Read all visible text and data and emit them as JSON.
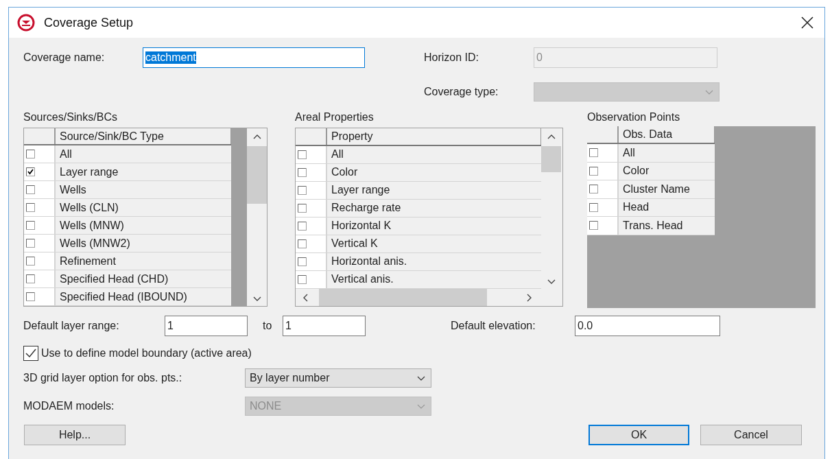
{
  "window": {
    "title": "Coverage Setup"
  },
  "coverage_name": {
    "label": "Coverage name:",
    "value": "catchment",
    "text_selected": true
  },
  "horizon_id": {
    "label": "Horizon ID:",
    "value": "0",
    "disabled": true
  },
  "coverage_type": {
    "label": "Coverage type:",
    "disabled": true
  },
  "sources_sinks": {
    "title": "Sources/Sinks/BCs",
    "column": "Source/Sink/BC Type",
    "rows": [
      {
        "label": "All",
        "checked": false
      },
      {
        "label": "Layer range",
        "checked": true
      },
      {
        "label": "Wells",
        "checked": false
      },
      {
        "label": "Wells (CLN)",
        "checked": false
      },
      {
        "label": "Wells (MNW)",
        "checked": false
      },
      {
        "label": "Wells (MNW2)",
        "checked": false
      },
      {
        "label": "Refinement",
        "checked": false
      },
      {
        "label": "Specified Head (CHD)",
        "checked": false
      },
      {
        "label": "Specified Head (IBOUND)",
        "checked": false
      }
    ]
  },
  "areal_properties": {
    "title": "Areal Properties",
    "column": "Property",
    "rows": [
      {
        "label": "All",
        "checked": false
      },
      {
        "label": "Color",
        "checked": false
      },
      {
        "label": "Layer range",
        "checked": false
      },
      {
        "label": "Recharge rate",
        "checked": false
      },
      {
        "label": "Horizontal K",
        "checked": false
      },
      {
        "label": "Vertical K",
        "checked": false
      },
      {
        "label": "Horizontal anis.",
        "checked": false
      },
      {
        "label": "Vertical anis.",
        "checked": false
      }
    ]
  },
  "observation_points": {
    "title": "Observation Points",
    "column": "Obs. Data",
    "rows": [
      {
        "label": "All",
        "checked": false
      },
      {
        "label": "Color",
        "checked": false
      },
      {
        "label": "Cluster Name",
        "checked": false
      },
      {
        "label": "Head",
        "checked": false
      },
      {
        "label": "Trans. Head",
        "checked": false
      }
    ]
  },
  "default_layer_range": {
    "label": "Default layer range:",
    "from": "1",
    "to_label": "to",
    "to": "1"
  },
  "default_elevation": {
    "label": "Default elevation:",
    "value": "0.0"
  },
  "model_boundary": {
    "label": "Use to define model boundary (active area)",
    "checked": true
  },
  "grid_layer_option": {
    "label": "3D grid layer option for obs. pts.:",
    "value": "By layer number",
    "disabled": false
  },
  "modaem_models": {
    "label": "MODAEM models:",
    "value": "NONE",
    "disabled": true
  },
  "buttons": [
    {
      "label": "Help...",
      "default": false
    },
    {
      "label": "OK",
      "default": true
    },
    {
      "label": "Cancel",
      "default": false
    }
  ]
}
